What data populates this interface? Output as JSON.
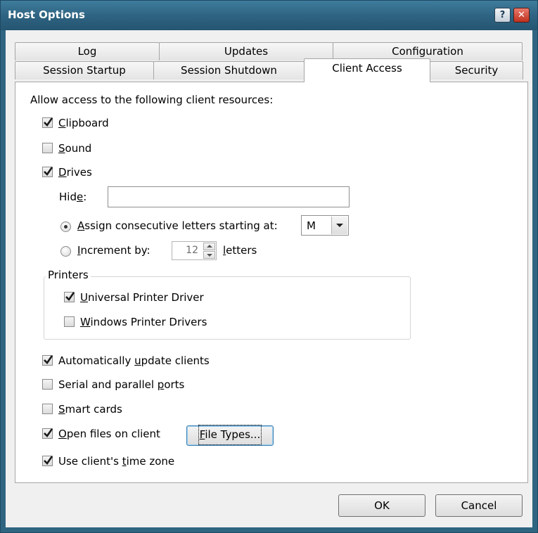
{
  "window": {
    "title": "Host Options",
    "help_glyph": "?",
    "close_glyph": "✕"
  },
  "tabs_row1": [
    "Log",
    "Updates",
    "Configuration"
  ],
  "tabs_row2": [
    "Session Startup",
    "Session Shutdown",
    "Client Access",
    "Security"
  ],
  "active_tab": "Client Access",
  "panel": {
    "intro": "Allow access to the following client resources:",
    "clipboard": {
      "pre": "",
      "key": "C",
      "post": "lipboard",
      "checked": true
    },
    "sound": {
      "pre": "",
      "key": "S",
      "post": "ound",
      "checked": false
    },
    "drives": {
      "pre": "",
      "key": "D",
      "post": "rives",
      "checked": true
    },
    "hide": {
      "pre": "Hid",
      "key": "e",
      "post": ":",
      "value": ""
    },
    "assign": {
      "pre": "",
      "key": "A",
      "post": "ssign consecutive letters starting at:",
      "selected": true
    },
    "drive_letter": "M",
    "increment": {
      "pre": "",
      "key": "I",
      "post": "ncrement by:",
      "selected": false
    },
    "increment_value": "12",
    "letters": {
      "pre": "",
      "key": "l",
      "post": "etters"
    },
    "printers_title": "Printers",
    "universal_printer": {
      "pre": "",
      "key": "U",
      "post": "niversal Printer Driver",
      "checked": true
    },
    "windows_printers": {
      "pre": "",
      "key": "W",
      "post": "indows Printer Drivers",
      "checked": false
    },
    "auto_update": {
      "pre": "Automatically ",
      "key": "u",
      "post": "pdate clients",
      "checked": true
    },
    "serial_ports": {
      "pre": "Serial and parallel ",
      "key": "p",
      "post": "orts",
      "checked": false
    },
    "smart_cards": {
      "pre": "",
      "key": "S",
      "post": "mart cards",
      "checked": false
    },
    "open_files": {
      "pre": "",
      "key": "O",
      "post": "pen files on client",
      "checked": true
    },
    "file_types_button": {
      "pre": "",
      "key": "F",
      "post": "ile Types..."
    },
    "time_zone": {
      "pre": "Use client's ",
      "key": "t",
      "post": "ime zone",
      "checked": true
    }
  },
  "footer": {
    "ok": "OK",
    "cancel": "Cancel"
  }
}
